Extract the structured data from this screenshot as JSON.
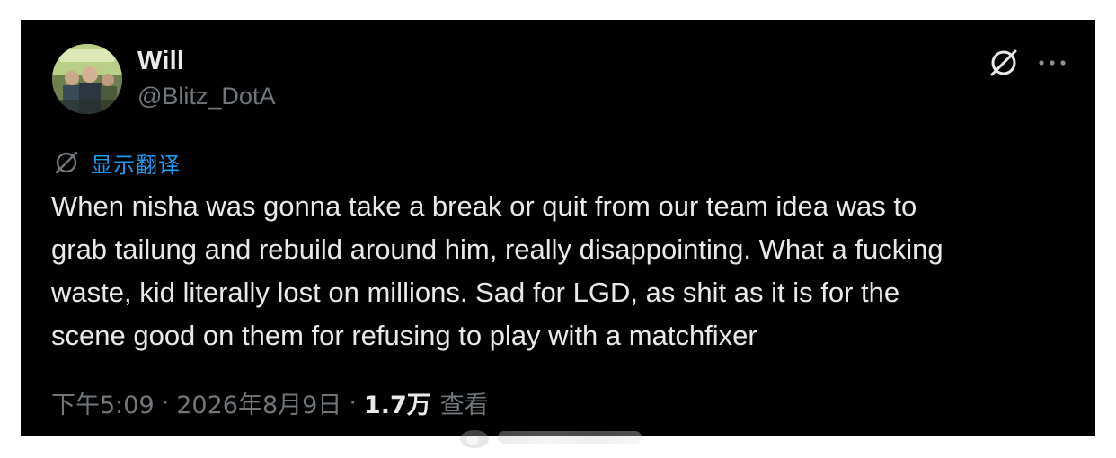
{
  "tweet": {
    "author_name": "Will",
    "author_handle": "@Blitz_DotA",
    "translate_label": "显示翻译",
    "text": "When nisha was gonna take a break or quit from our team idea was to\ngrab tailung and rebuild around him, really disappointing. What a fucking\nwaste, kid literally lost on millions. Sad for LGD, as shit as it is for the\nscene good on them for refusing to play with a matchfixer",
    "time": "下午5:09",
    "separator": "·",
    "date": "2026年8月9日",
    "views_count": "1.7万",
    "views_label": "查看"
  },
  "icons": {
    "avatar": "avatar-photo",
    "grok": "grok-icon",
    "more": "more-horizontal-icon",
    "translate": "translate-icon"
  },
  "colors": {
    "card_background": "#000000",
    "primary_text": "#e7e9ea",
    "secondary_text": "#71767b",
    "link_blue": "#1d9bf0"
  }
}
